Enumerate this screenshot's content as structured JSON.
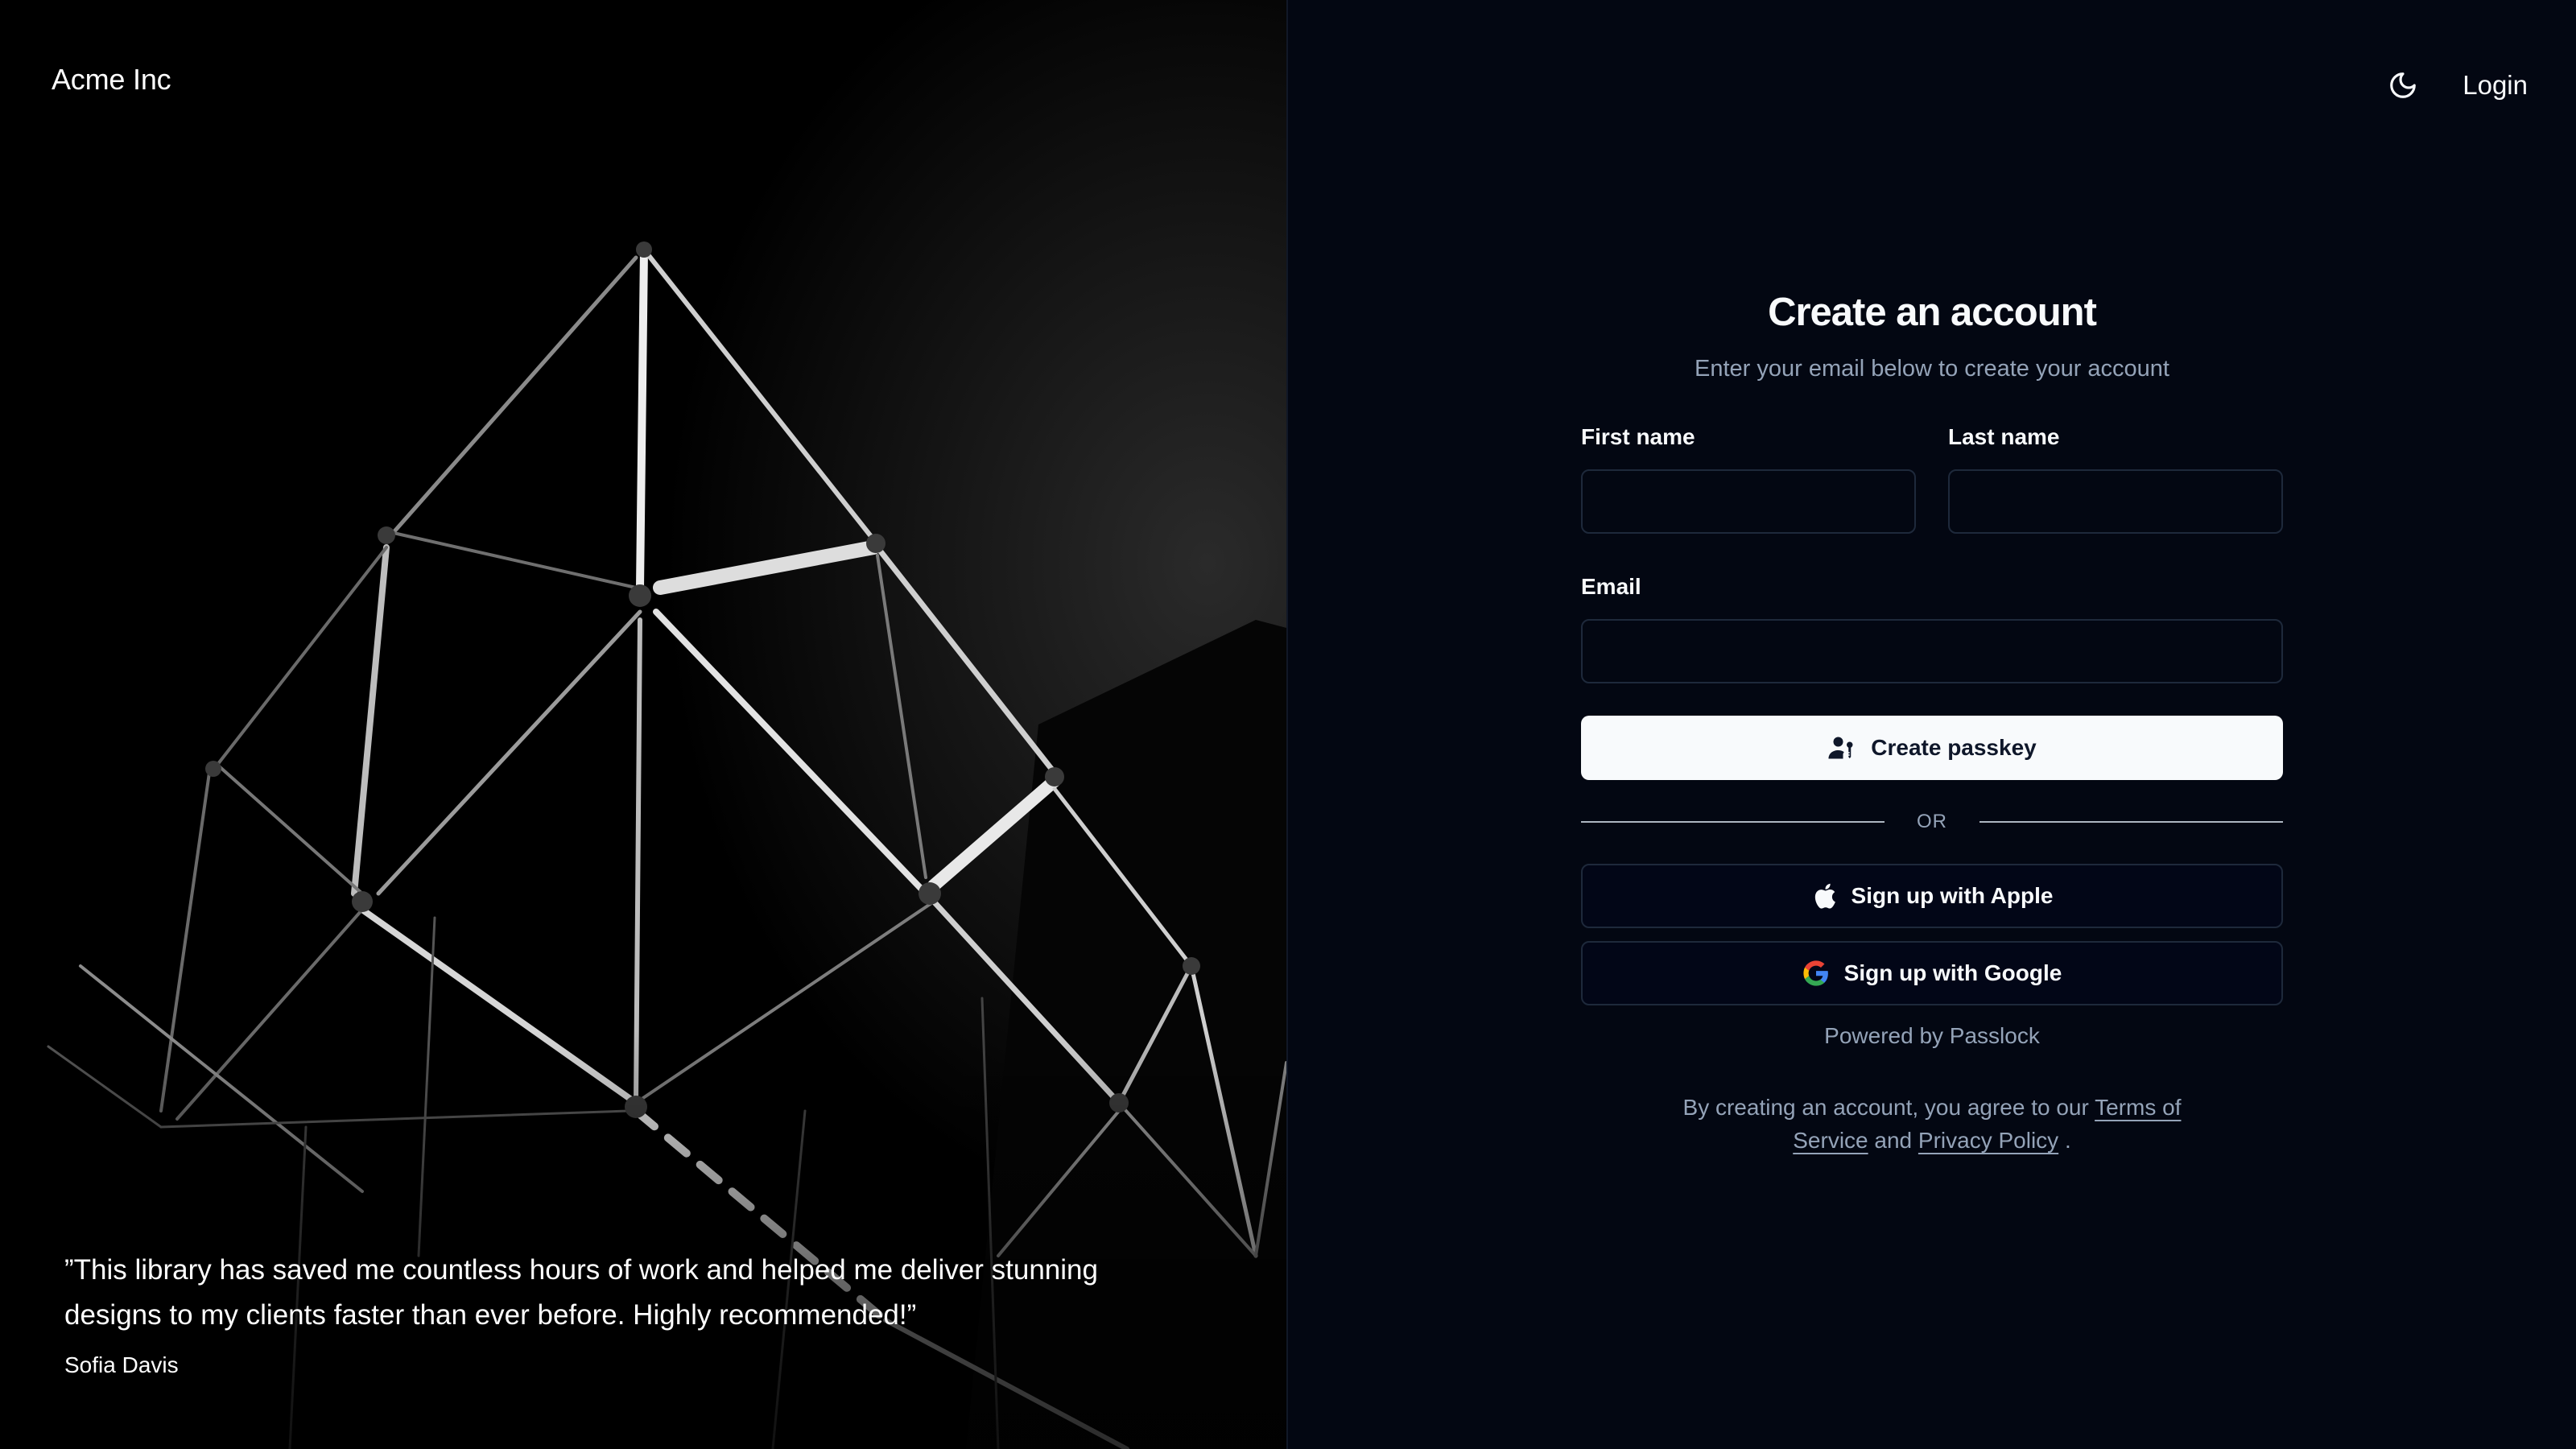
{
  "brand": {
    "name": "Acme Inc"
  },
  "testimonial": {
    "quote": "”This library has saved me countless hours of work and helped me deliver stunning designs to my clients faster than ever before. Highly recommended!”",
    "author": "Sofia Davis"
  },
  "topbar": {
    "theme_icon": "moon-icon",
    "login_label": "Login"
  },
  "form": {
    "title": "Create an account",
    "subtitle": "Enter your email below to create your account",
    "first_name_label": "First name",
    "first_name_value": "",
    "last_name_label": "Last name",
    "last_name_value": "",
    "email_label": "Email",
    "email_value": "",
    "passkey_button": "Create passkey",
    "separator": "OR",
    "apple_button": "Sign up with Apple",
    "google_button": "Sign up with Google",
    "powered_by": "Powered by Passlock"
  },
  "legal": {
    "prefix": "By creating an account, you agree to our",
    "terms_link": "Terms of Service",
    "and_text": "and",
    "privacy_link": "Privacy Policy",
    "suffix": "."
  },
  "colors": {
    "background": "#030712",
    "panel_border": "#1e293b",
    "primary_button_bg": "#f8fafc",
    "muted_text": "#94a3b8"
  }
}
